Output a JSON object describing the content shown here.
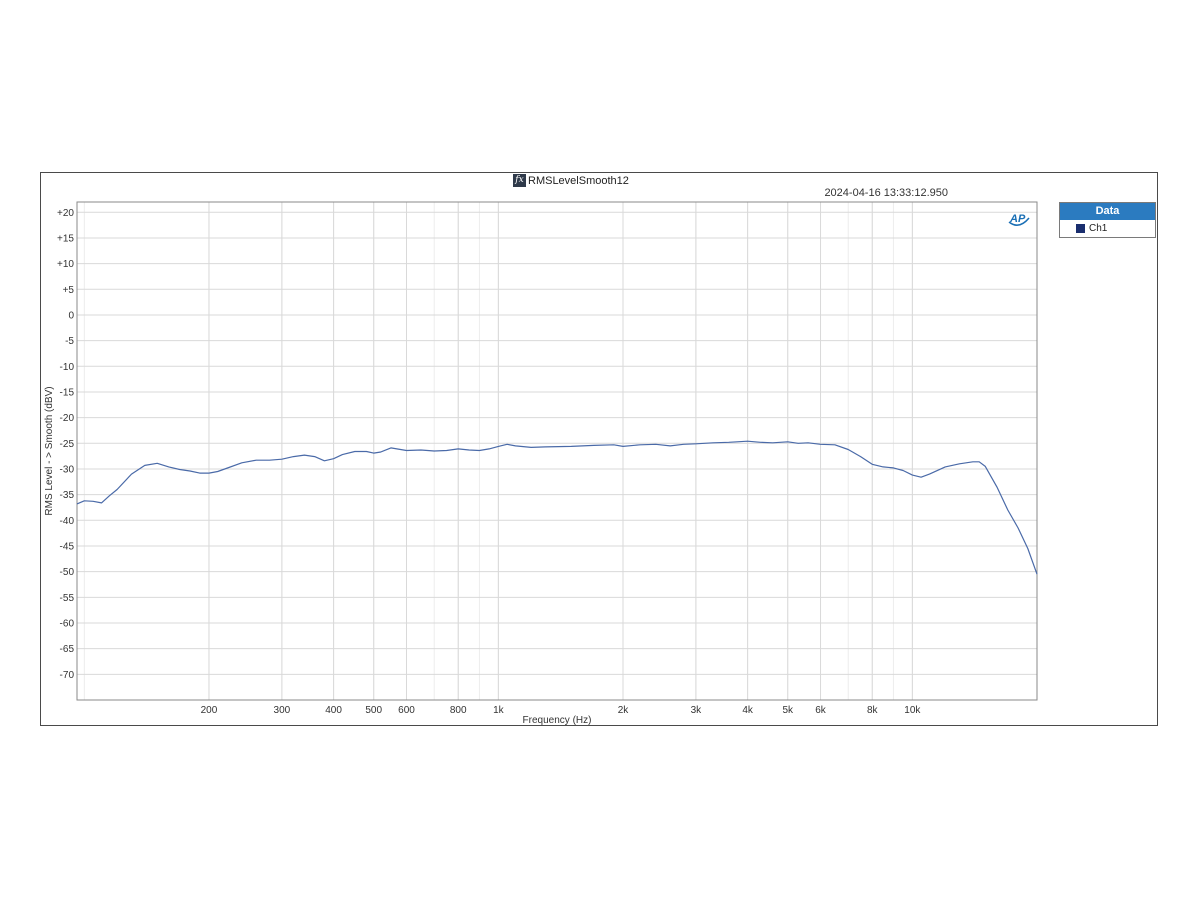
{
  "header": {
    "title": "RMSLevelSmooth12",
    "fx_icon_label": "fx",
    "timestamp": "2024-04-16 13:33:12.950",
    "logo_text": "AP"
  },
  "legend": {
    "title": "Data",
    "items": [
      {
        "label": "Ch1",
        "color": "#1a2e6e"
      }
    ]
  },
  "colors": {
    "series": "#4a6aa8",
    "grid": "#d9d9d9",
    "legend_header": "#2b7bc0",
    "logo": "#1a6fb5"
  },
  "chart_data": {
    "type": "line",
    "xlabel": "Frequency (Hz)",
    "ylabel": "RMS Level - > Smooth (dBV)",
    "x_scale": "log",
    "xlim": [
      96,
      20000
    ],
    "ylim": [
      -75,
      22
    ],
    "grid": true,
    "legend_position": "right",
    "x_tick_labels": [
      {
        "value": 200,
        "label": "200"
      },
      {
        "value": 300,
        "label": "300"
      },
      {
        "value": 400,
        "label": "400"
      },
      {
        "value": 500,
        "label": "500"
      },
      {
        "value": 600,
        "label": "600"
      },
      {
        "value": 800,
        "label": "800"
      },
      {
        "value": 1000,
        "label": "1k"
      },
      {
        "value": 2000,
        "label": "2k"
      },
      {
        "value": 3000,
        "label": "3k"
      },
      {
        "value": 4000,
        "label": "4k"
      },
      {
        "value": 5000,
        "label": "5k"
      },
      {
        "value": 6000,
        "label": "6k"
      },
      {
        "value": 8000,
        "label": "8k"
      },
      {
        "value": 10000,
        "label": "10k"
      }
    ],
    "y_tick_labels": [
      {
        "value": 20,
        "label": "+20"
      },
      {
        "value": 15,
        "label": "+15"
      },
      {
        "value": 10,
        "label": "+10"
      },
      {
        "value": 5,
        "label": "+5"
      },
      {
        "value": 0,
        "label": "0"
      },
      {
        "value": -5,
        "label": "-5"
      },
      {
        "value": -10,
        "label": "-10"
      },
      {
        "value": -15,
        "label": "-15"
      },
      {
        "value": -20,
        "label": "-20"
      },
      {
        "value": -25,
        "label": "-25"
      },
      {
        "value": -30,
        "label": "-30"
      },
      {
        "value": -35,
        "label": "-35"
      },
      {
        "value": -40,
        "label": "-40"
      },
      {
        "value": -45,
        "label": "-45"
      },
      {
        "value": -50,
        "label": "-50"
      },
      {
        "value": -55,
        "label": "-55"
      },
      {
        "value": -60,
        "label": "-60"
      },
      {
        "value": -65,
        "label": "-65"
      },
      {
        "value": -70,
        "label": "-70"
      }
    ],
    "series": [
      {
        "name": "Ch1",
        "x": [
          96,
          100,
          105,
          110,
          115,
          120,
          130,
          140,
          150,
          160,
          170,
          180,
          190,
          200,
          210,
          220,
          240,
          260,
          280,
          300,
          320,
          340,
          360,
          380,
          400,
          420,
          450,
          480,
          500,
          520,
          550,
          600,
          650,
          700,
          750,
          800,
          850,
          900,
          950,
          1000,
          1050,
          1100,
          1200,
          1300,
          1500,
          1700,
          1900,
          2000,
          2200,
          2400,
          2600,
          2800,
          3000,
          3300,
          3600,
          4000,
          4300,
          4600,
          5000,
          5300,
          5600,
          6000,
          6500,
          7000,
          7500,
          8000,
          8500,
          9000,
          9500,
          10000,
          10500,
          11000,
          12000,
          13000,
          14000,
          14500,
          15000,
          16000,
          17000,
          18000,
          19000,
          20000
        ],
        "y": [
          -36.8,
          -36.2,
          -36.3,
          -36.6,
          -35.2,
          -34.0,
          -31.0,
          -29.3,
          -28.9,
          -29.6,
          -30.1,
          -30.4,
          -30.8,
          -30.8,
          -30.5,
          -29.9,
          -28.8,
          -28.3,
          -28.3,
          -28.1,
          -27.6,
          -27.3,
          -27.6,
          -28.4,
          -28.0,
          -27.2,
          -26.6,
          -26.6,
          -26.9,
          -26.7,
          -25.9,
          -26.4,
          -26.3,
          -26.5,
          -26.4,
          -26.1,
          -26.3,
          -26.4,
          -26.1,
          -25.6,
          -25.2,
          -25.5,
          -25.8,
          -25.7,
          -25.6,
          -25.4,
          -25.3,
          -25.6,
          -25.3,
          -25.2,
          -25.5,
          -25.2,
          -25.1,
          -24.9,
          -24.8,
          -24.6,
          -24.8,
          -24.9,
          -24.7,
          -25.0,
          -24.9,
          -25.2,
          -25.3,
          -26.2,
          -27.6,
          -29.1,
          -29.6,
          -29.8,
          -30.3,
          -31.2,
          -31.6,
          -31.0,
          -29.6,
          -29.0,
          -28.6,
          -28.6,
          -29.5,
          -33.5,
          -38.0,
          -41.5,
          -45.5,
          -50.5
        ]
      }
    ]
  }
}
